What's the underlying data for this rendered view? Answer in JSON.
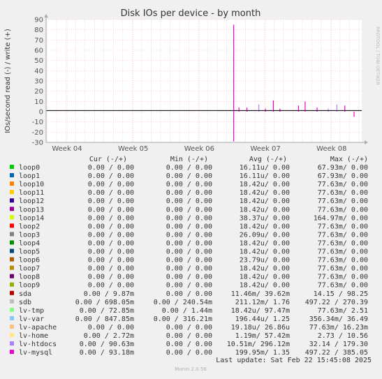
{
  "chart_data": {
    "type": "line",
    "title": "Disk IOs per device - by month",
    "ylabel": "IOs/second read (-) / write (+)",
    "xlabel": "",
    "x_ticks": [
      "Week 04",
      "Week 05",
      "Week 06",
      "Week 07",
      "Week 08"
    ],
    "y_ticks": [
      "90",
      "80",
      "70",
      "60",
      "50",
      "40",
      "30",
      "20",
      "10",
      "0",
      "-10",
      "-20",
      "-30"
    ],
    "ylim": [
      -30,
      90
    ],
    "grid": true,
    "legend_placement": "bottom-table",
    "series": [
      {
        "name": "loop0",
        "color": "#00cc00",
        "cur": "0.00 /   0.00",
        "min": "0.00 /   0.00",
        "avg": "16.11u/   0.00",
        "max": "67.93m/   0.00"
      },
      {
        "name": "loop1",
        "color": "#0066b3",
        "cur": "0.00 /   0.00",
        "min": "0.00 /   0.00",
        "avg": "16.11u/   0.00",
        "max": "67.93m/   0.00"
      },
      {
        "name": "loop10",
        "color": "#ff8000",
        "cur": "0.00 /   0.00",
        "min": "0.00 /   0.00",
        "avg": "18.42u/   0.00",
        "max": "77.63m/   0.00"
      },
      {
        "name": "loop11",
        "color": "#ffcc00",
        "cur": "0.00 /   0.00",
        "min": "0.00 /   0.00",
        "avg": "18.42u/   0.00",
        "max": "77.63m/   0.00"
      },
      {
        "name": "loop12",
        "color": "#330099",
        "cur": "0.00 /   0.00",
        "min": "0.00 /   0.00",
        "avg": "18.42u/   0.00",
        "max": "77.63m/   0.00"
      },
      {
        "name": "loop13",
        "color": "#990099",
        "cur": "0.00 /   0.00",
        "min": "0.00 /   0.00",
        "avg": "18.42u/   0.00",
        "max": "77.63m/   0.00"
      },
      {
        "name": "loop14",
        "color": "#ccff00",
        "cur": "0.00 /   0.00",
        "min": "0.00 /   0.00",
        "avg": "38.37u/   0.00",
        "max": "164.97m/   0.00"
      },
      {
        "name": "loop2",
        "color": "#ff0000",
        "cur": "0.00 /   0.00",
        "min": "0.00 /   0.00",
        "avg": "18.42u/   0.00",
        "max": "77.63m/   0.00"
      },
      {
        "name": "loop3",
        "color": "#808080",
        "cur": "0.00 /   0.00",
        "min": "0.00 /   0.00",
        "avg": "26.09u/   0.00",
        "max": "77.63m/   0.00"
      },
      {
        "name": "loop4",
        "color": "#008f00",
        "cur": "0.00 /   0.00",
        "min": "0.00 /   0.00",
        "avg": "18.42u/   0.00",
        "max": "77.63m/   0.00"
      },
      {
        "name": "loop5",
        "color": "#00487d",
        "cur": "0.00 /   0.00",
        "min": "0.00 /   0.00",
        "avg": "18.42u/   0.00",
        "max": "77.63m/   0.00"
      },
      {
        "name": "loop6",
        "color": "#b35a00",
        "cur": "0.00 /   0.00",
        "min": "0.00 /   0.00",
        "avg": "23.79u/   0.00",
        "max": "77.63m/   0.00"
      },
      {
        "name": "loop7",
        "color": "#b38f00",
        "cur": "0.00 /   0.00",
        "min": "0.00 /   0.00",
        "avg": "18.42u/   0.00",
        "max": "77.63m/   0.00"
      },
      {
        "name": "loop8",
        "color": "#6b006b",
        "cur": "0.00 /   0.00",
        "min": "0.00 /   0.00",
        "avg": "18.42u/   0.00",
        "max": "77.63m/   0.00"
      },
      {
        "name": "loop9",
        "color": "#8fb300",
        "cur": "0.00 /   0.00",
        "min": "0.00 /   0.00",
        "avg": "18.42u/   0.00",
        "max": "77.63m/   0.00"
      },
      {
        "name": "sda",
        "color": "#b30000",
        "cur": "0.00 /   9.87m",
        "min": "0.00 /   0.00",
        "avg": "11.46m/  39.62m",
        "max": "14.15 /  98.25"
      },
      {
        "name": "sdb",
        "color": "#bebebe",
        "cur": "0.00 / 698.05m",
        "min": "0.00 / 240.54m",
        "avg": "211.12m/   1.76",
        "max": "497.22 / 270.39"
      },
      {
        "name": "lv-tmp",
        "color": "#80ff80",
        "cur": "0.00 /  72.85m",
        "min": "0.00 /   1.44m",
        "avg": "18.42u/  97.47m",
        "max": "77.63m/   2.51"
      },
      {
        "name": "lv-var",
        "color": "#80c9ff",
        "cur": "0.00 / 847.85m",
        "min": "0.00 / 316.21m",
        "avg": "196.44u/   1.25",
        "max": "356.34m/  36.49"
      },
      {
        "name": "lv-apache",
        "color": "#ffc080",
        "cur": "0.00 /   0.00",
        "min": "0.00 /   0.00",
        "avg": "19.18u/  26.86u",
        "max": "77.63m/  16.23m"
      },
      {
        "name": "lv-home",
        "color": "#ffe680",
        "cur": "0.00 /   2.72m",
        "min": "0.00 /   0.00",
        "avg": "1.19m/  57.42m",
        "max": "2.73 /  10.56"
      },
      {
        "name": "lv-htdocs",
        "color": "#aa80ff",
        "cur": "0.00 /  90.63m",
        "min": "0.00 /   0.00",
        "avg": "10.51m/ 296.12m",
        "max": "32.14 / 179.30"
      },
      {
        "name": "lv-mysql",
        "color": "#ee00cc",
        "cur": "0.00 /  93.18m",
        "min": "0.00 /   0.00",
        "avg": "199.95m/   1.35",
        "max": "497.22 / 385.05"
      }
    ],
    "activity": {
      "week_labels_week_index": [
        0,
        1,
        2,
        3,
        4
      ],
      "spikes": [
        {
          "week": 2.52,
          "value": 85,
          "color": "#ee00cc"
        },
        {
          "week": 2.52,
          "value": -29,
          "color": "#ee00cc"
        },
        {
          "week": 2.6,
          "value": 4,
          "color": "#ee00cc"
        },
        {
          "week": 2.72,
          "value": 4,
          "color": "#ee00cc"
        },
        {
          "week": 3.0,
          "value": 3,
          "color": "#ee00cc"
        },
        {
          "week": 3.12,
          "value": 11,
          "color": "#ee00cc"
        },
        {
          "week": 3.22,
          "value": 3,
          "color": "#ee00cc"
        },
        {
          "week": 3.5,
          "value": 6,
          "color": "#ee00cc"
        },
        {
          "week": 3.6,
          "value": 10,
          "color": "#ee00cc"
        },
        {
          "week": 3.78,
          "value": 4,
          "color": "#ee00cc"
        },
        {
          "week": 4.08,
          "value": 7,
          "color": "#aa80ff"
        },
        {
          "week": 4.2,
          "value": 6,
          "color": "#ee00cc"
        },
        {
          "week": 4.34,
          "value": -5,
          "color": "#ee00cc"
        },
        {
          "week": 2.9,
          "value": 7,
          "color": "#aa80ff"
        },
        {
          "week": 3.95,
          "value": 3,
          "color": "#aa80ff"
        }
      ],
      "baseline_start_week": 2.3,
      "baseline_end_week": 4.45
    }
  },
  "table_header": {
    "cur": "Cur (-/+)",
    "min": "Min (-/+)",
    "avg": "Avg (-/+)",
    "max": "Max (-/+)"
  },
  "side_label": "RRDTOOL / TOBI OETIKER",
  "footer": {
    "last_update": "Last update: Sat Feb 22 15:45:08 2025",
    "version": "Munin 2.0.56"
  }
}
